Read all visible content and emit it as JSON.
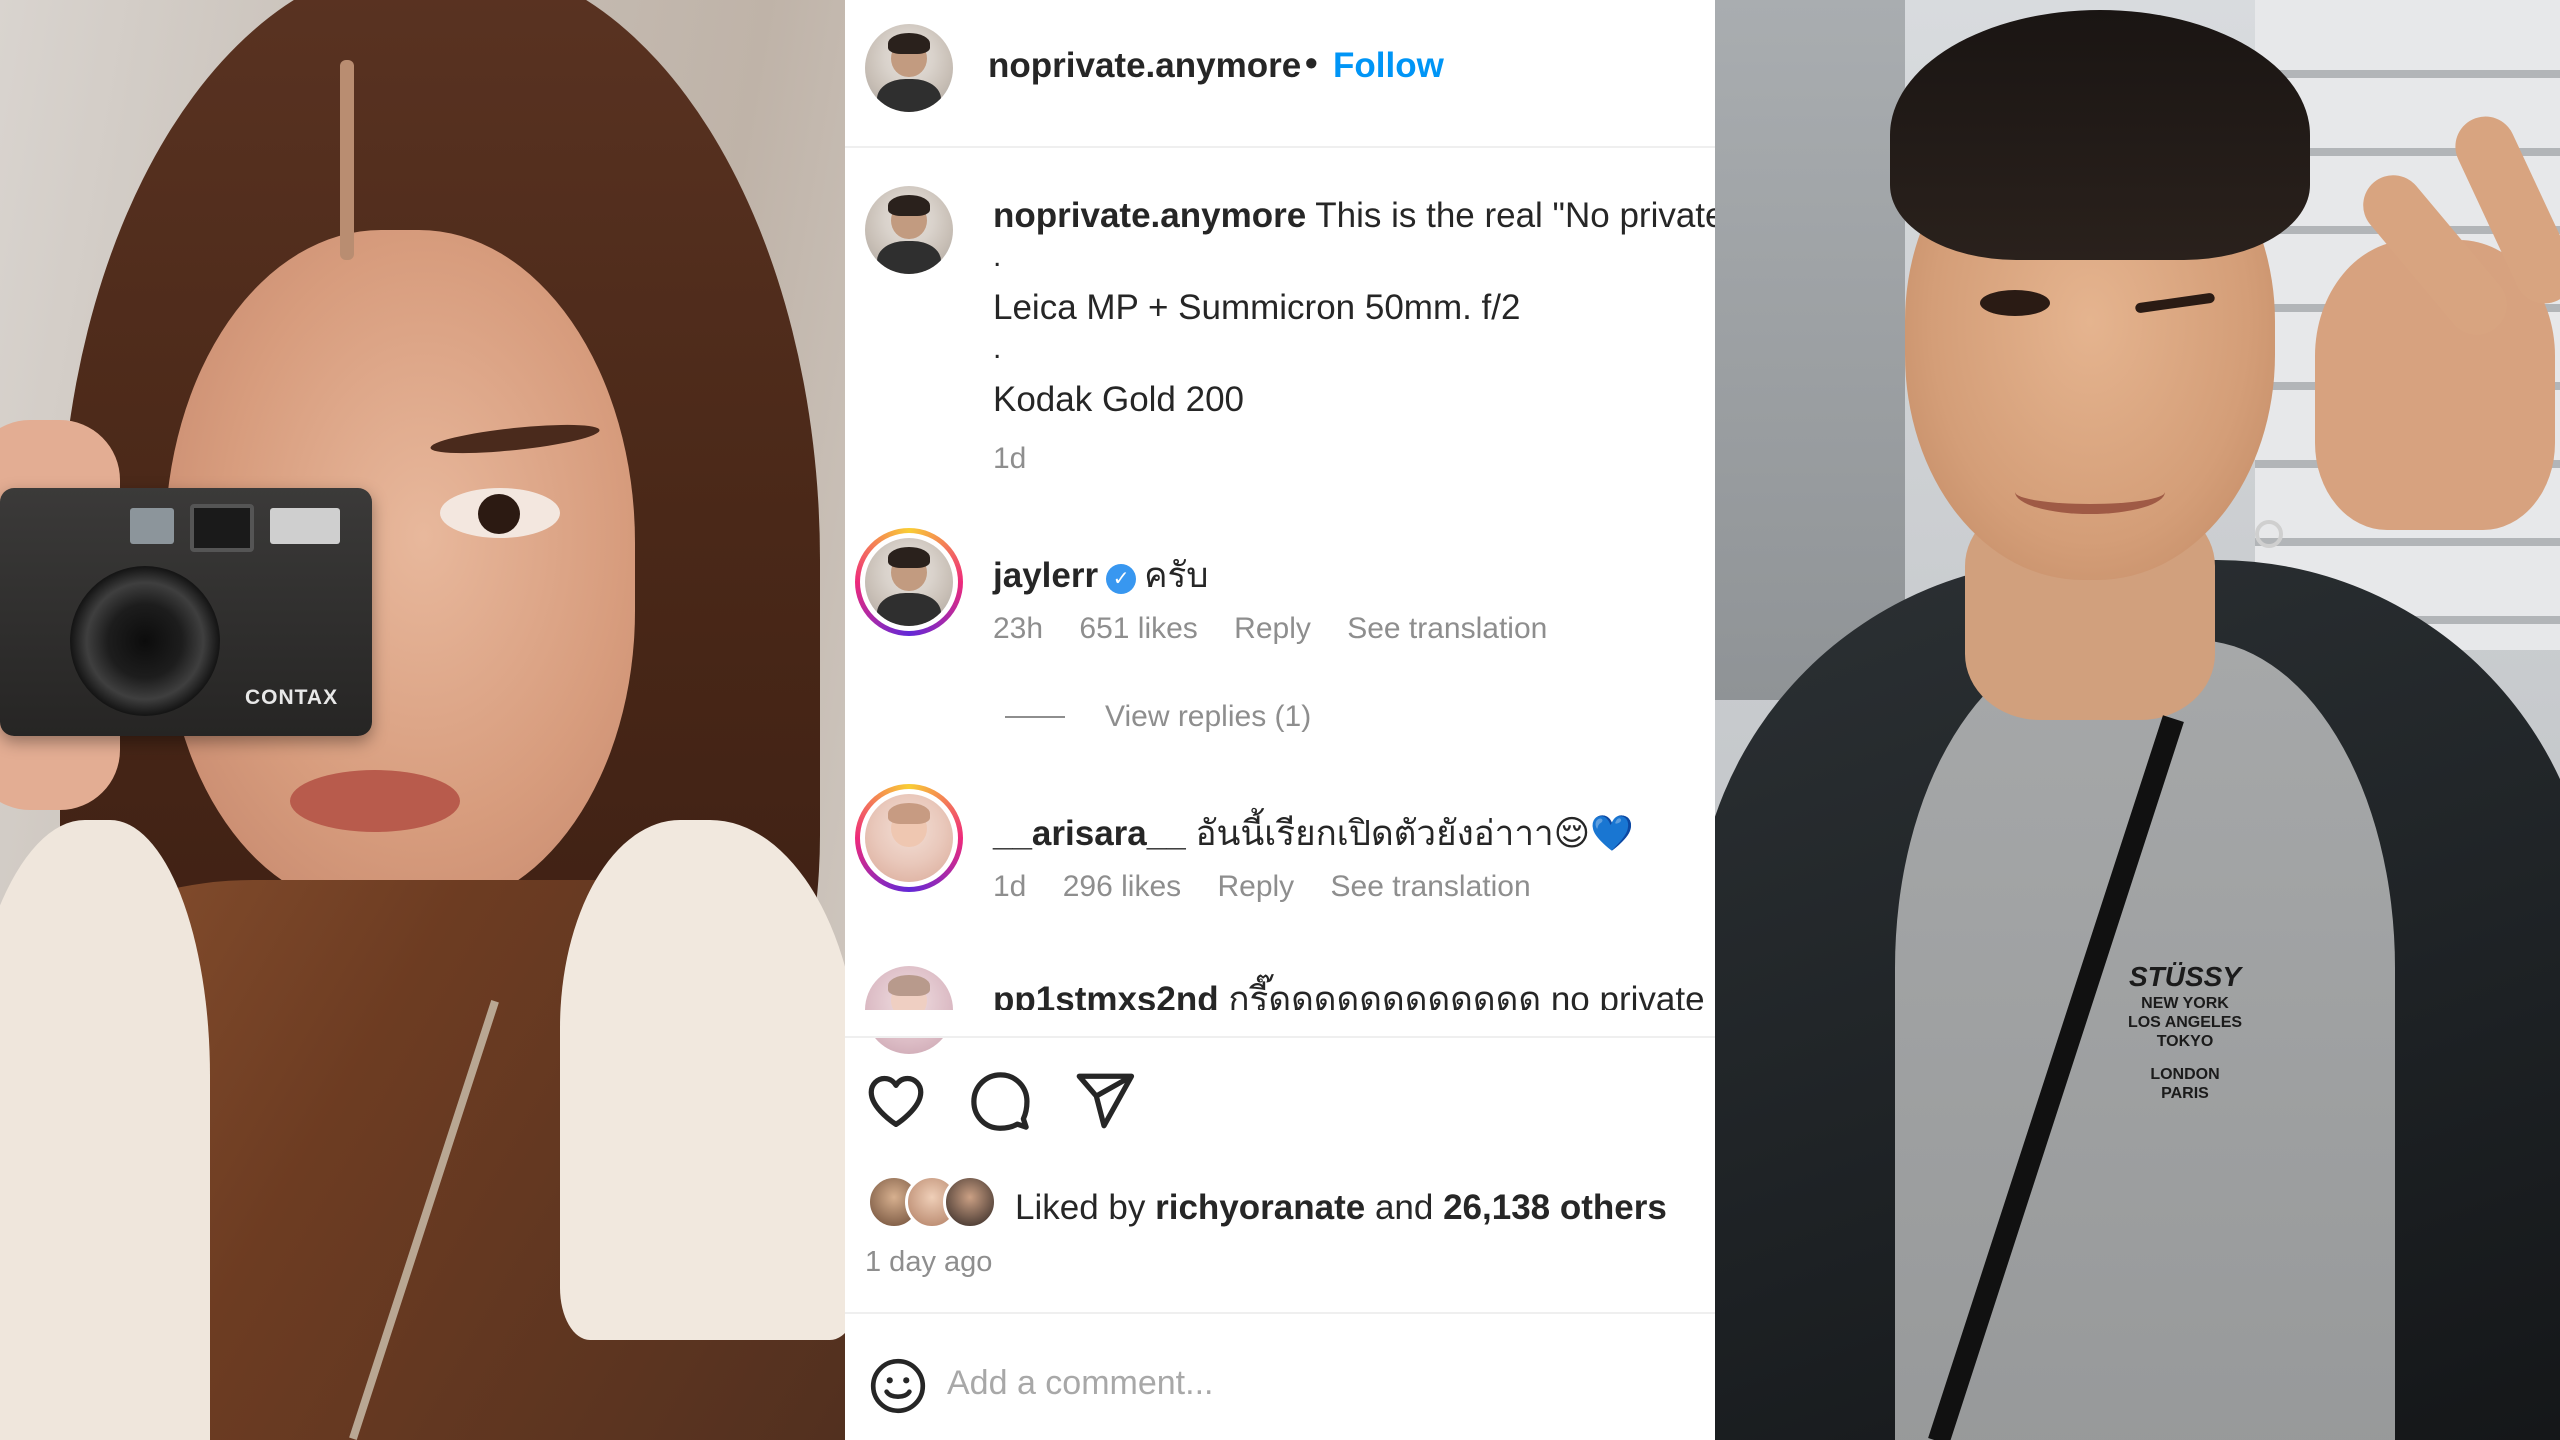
{
  "post": {
    "header": {
      "username": "noprivate.anymore",
      "separator": "•",
      "follow_label": "Follow"
    },
    "caption": {
      "username": "noprivate.anymore",
      "text": "This is the real \"No private",
      "dot1": ".",
      "line2": "Leica MP + Summicron 50mm. f/2",
      "dot2": ".",
      "line3": "Kodak Gold 200",
      "time": "1d"
    },
    "comments": [
      {
        "username": "jaylerr",
        "verified": true,
        "text": "ครับ",
        "time": "23h",
        "likes": "651 likes",
        "reply_label": "Reply",
        "translation_label": "See translation",
        "view_replies": "View replies (1)"
      },
      {
        "username": "__arisara__",
        "text": "อันนี้เรียกเปิดตัวยังอ่าาา😌",
        "heart": "💙",
        "time": "1d",
        "likes": "296 likes",
        "reply_label": "Reply",
        "translation_label": "See translation"
      },
      {
        "username": "pp1stmxs2nd",
        "text": "กรี๊ดดดดดดดดดดดด no private a"
      }
    ],
    "actions": {
      "like_icon": "heart-icon",
      "comment_icon": "comment-icon",
      "share_icon": "send-icon"
    },
    "likes": {
      "prefix": "Liked by",
      "user": "richyoranate",
      "middle": "and",
      "others": "26,138 others"
    },
    "posted_ago": "1 day ago",
    "add_comment": {
      "emoji_icon": "smiley-icon",
      "placeholder": "Add a comment..."
    }
  },
  "left_photo": {
    "camera_brand": "CONTAX"
  },
  "right_photo": {
    "shirt_logo_lines": [
      "STÜSSY",
      "NEW YORK",
      "LOS ANGELES",
      "TOKYO",
      "LONDON",
      "PARIS"
    ]
  },
  "colors": {
    "link_blue": "#0095f6",
    "text_primary": "#262626",
    "text_secondary": "#8e8e8e",
    "verified_blue": "#3897f0"
  }
}
